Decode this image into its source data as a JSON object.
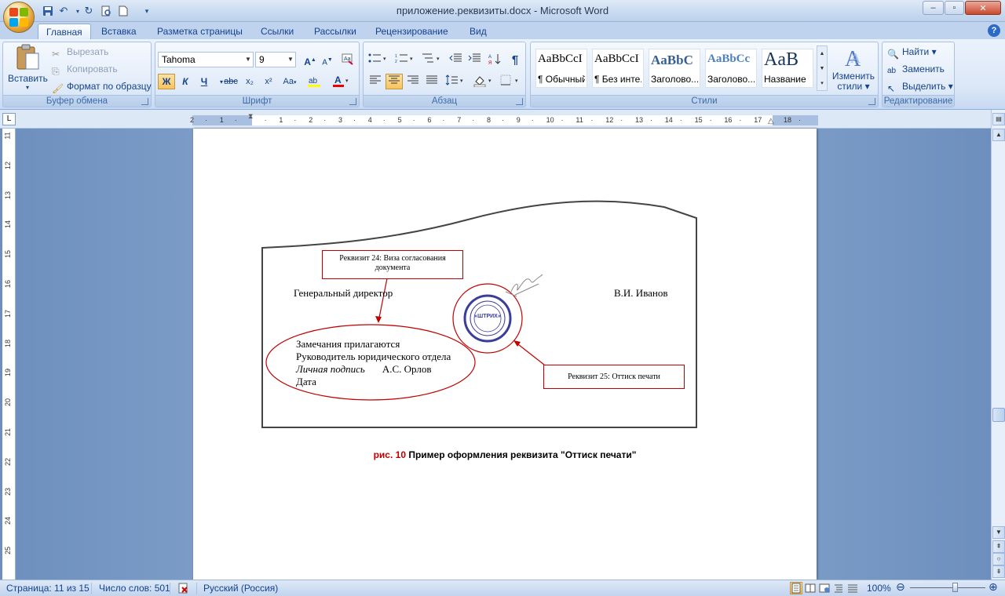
{
  "window": {
    "title": "приложение.реквизиты.docx - Microsoft Word",
    "controls": {
      "minimize": "–",
      "maximize": "▫",
      "close": "✕"
    }
  },
  "quick_access": [
    "save-icon",
    "undo-icon",
    "redo-icon",
    "print-preview-icon",
    "new-document-icon",
    "customize-icon"
  ],
  "tabs": [
    {
      "label": "Главная",
      "active": true
    },
    {
      "label": "Вставка"
    },
    {
      "label": "Разметка страницы"
    },
    {
      "label": "Ссылки"
    },
    {
      "label": "Рассылки"
    },
    {
      "label": "Рецензирование"
    },
    {
      "label": "Вид"
    }
  ],
  "ribbon": {
    "clipboard": {
      "label": "Буфер обмена",
      "paste": "Вставить",
      "cut": "Вырезать",
      "copy": "Копировать",
      "format_painter": "Формат по образцу"
    },
    "font": {
      "label": "Шрифт",
      "font_name": "Tahoma",
      "font_size": "9",
      "bold": "Ж",
      "italic": "К",
      "underline": "Ч",
      "strike": "abc",
      "subscript": "x₂",
      "superscript": "x²",
      "change_case": "Aa",
      "grow": "A",
      "shrink": "A"
    },
    "paragraph": {
      "label": "Абзац",
      "pilcrow": "¶"
    },
    "styles": {
      "label": "Стили",
      "items": [
        {
          "sample": "AaBbCcI",
          "name": "¶ Обычный"
        },
        {
          "sample": "AaBbCcI",
          "name": "¶ Без инте..."
        },
        {
          "sample": "AaBbC",
          "name": "Заголово..."
        },
        {
          "sample": "AaBbCc",
          "name": "Заголово..."
        },
        {
          "sample": "AaB",
          "name": "Название"
        }
      ],
      "change_styles": [
        "Изменить",
        "стили ▾"
      ]
    },
    "editing": {
      "label": "Редактирование",
      "find": "Найти ▾",
      "replace": "Заменить",
      "select": "Выделить ▾"
    }
  },
  "ruler": {
    "h_marks": [
      "2",
      "1",
      "",
      "1",
      "2",
      "3",
      "4",
      "5",
      "6",
      "7",
      "8",
      "9",
      "10",
      "11",
      "12",
      "13",
      "14",
      "15",
      "16",
      "17",
      "18"
    ],
    "v_marks": [
      "11",
      "12",
      "13",
      "14",
      "15",
      "16",
      "17",
      "18",
      "19",
      "20",
      "21",
      "22",
      "23",
      "24",
      "25"
    ],
    "corner": "L"
  },
  "document": {
    "callout_24": "Реквизит 24: Виза согласования документа",
    "position_title": "Генеральный директор",
    "signer_name": "В.И. Иванов",
    "stamp_text": "«ШТРИХ»",
    "visa_lines": {
      "line1": "Замечания прилагаются",
      "line2": "Руководитель юридического отдела",
      "line3_italic": "Личная подпись",
      "line3_name": "А.С. Орлов",
      "line4": "Дата"
    },
    "callout_25": "Реквизит 25: Оттиск печати",
    "caption_num": "рис. 10",
    "caption_text": "Пример оформления реквизита \"Оттиск печати\""
  },
  "status": {
    "page": "Страница: 11 из 15",
    "words": "Число слов: 501",
    "language": "Русский (Россия)",
    "zoom": "100%",
    "zoom_level": 1.0
  },
  "colors": {
    "accent_red": "#c00000",
    "ribbon_blue": "#15428b",
    "workspace": "#8aa9d1"
  }
}
